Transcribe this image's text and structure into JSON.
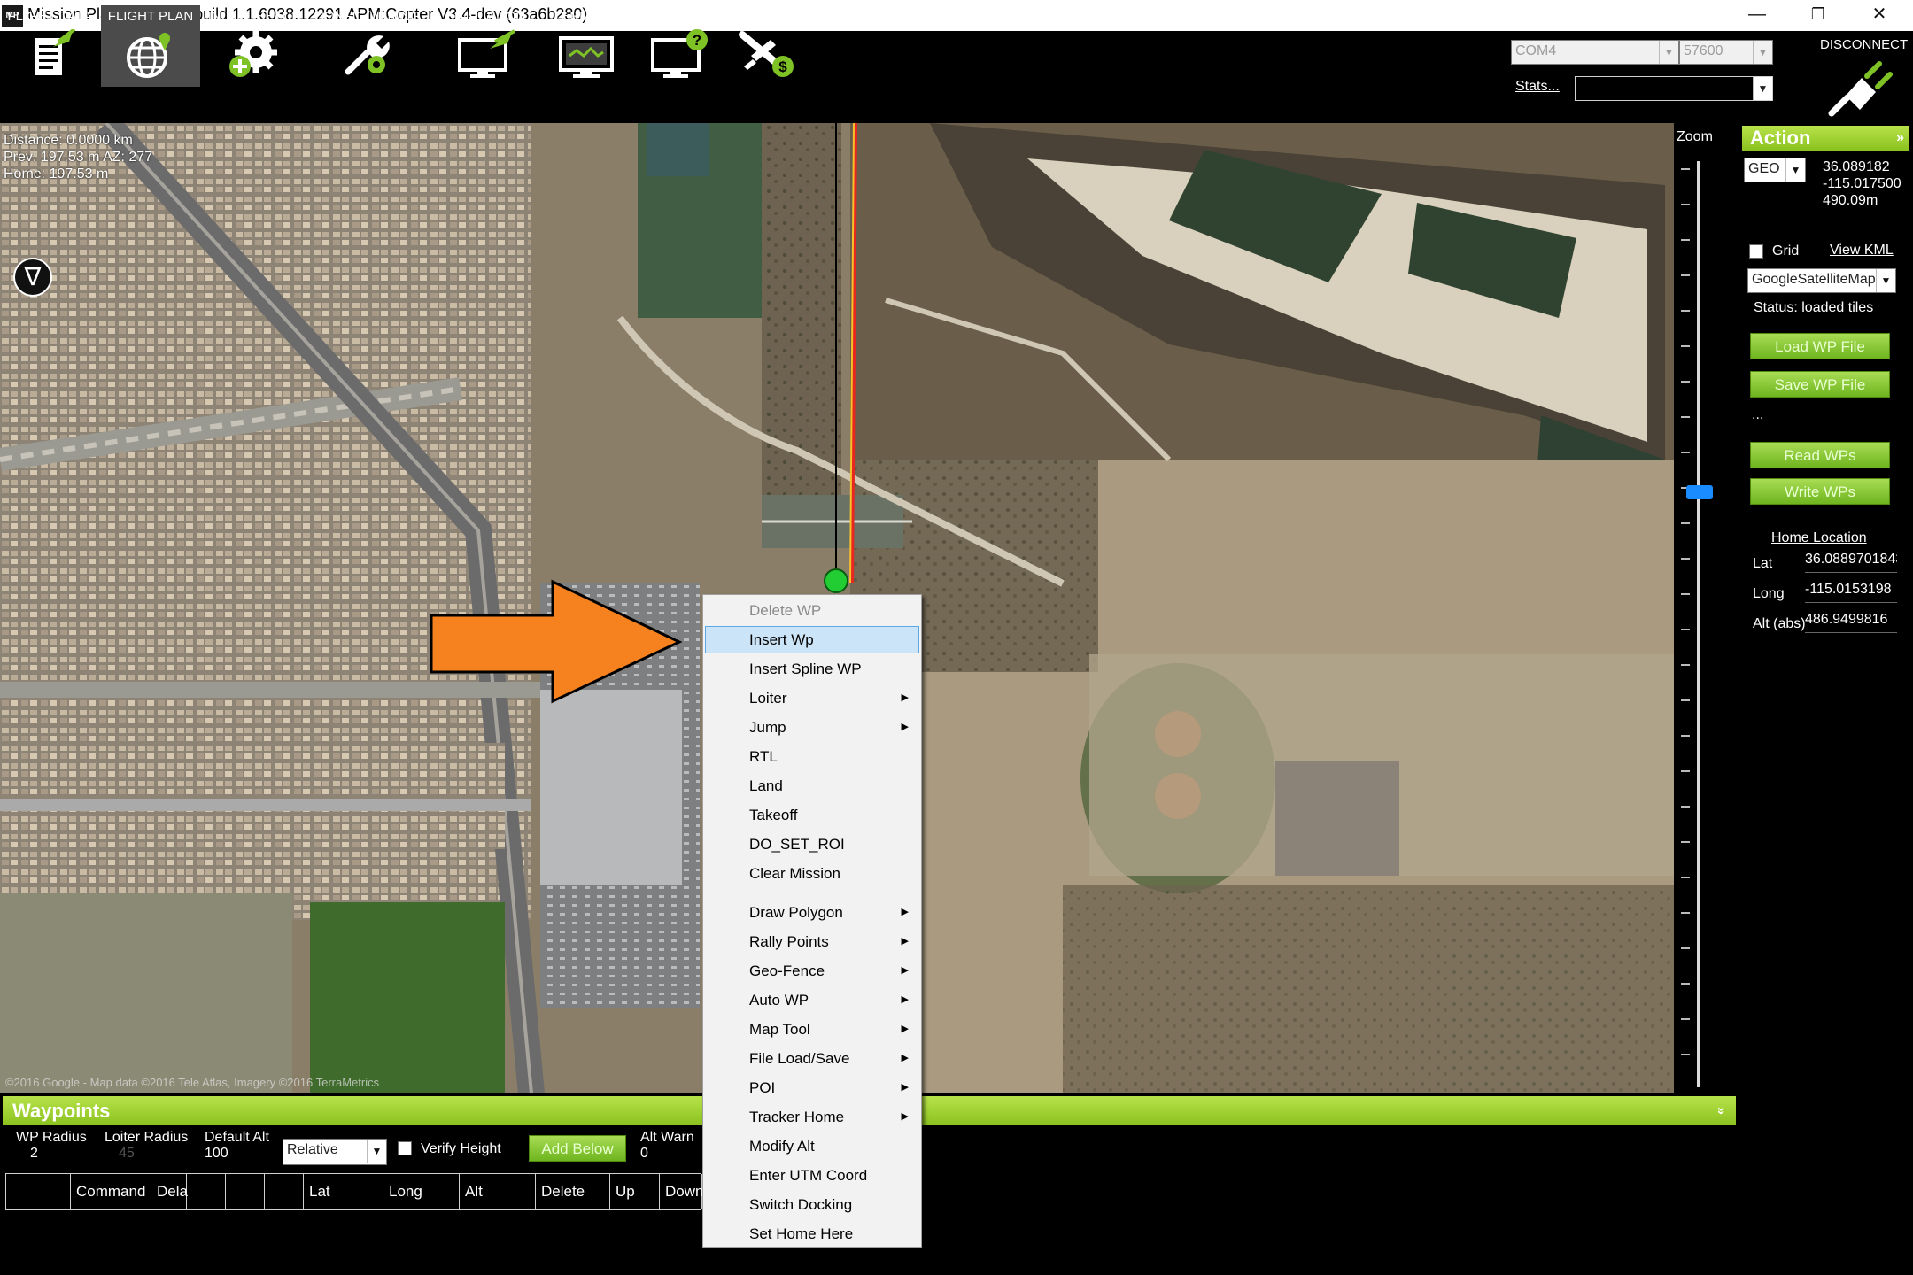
{
  "window": {
    "title": "Mission Planner 1.3.39 build 1.1.6038.12291 APM:Copter V3.4-dev (63a6b280)",
    "icon_label": "MP",
    "minimize_glyph": "—",
    "restore_glyph": "❐",
    "close_glyph": "✕"
  },
  "toolbar": {
    "items": [
      {
        "label": "FLIGHT DATA",
        "icon": "flight-data-icon"
      },
      {
        "label": "FLIGHT PLAN",
        "icon": "flight-plan-icon",
        "active": true
      },
      {
        "label": "INITIAL SETUP",
        "icon": "initial-setup-icon"
      },
      {
        "label": "CONFIG/TUNING",
        "icon": "config-tuning-icon"
      },
      {
        "label": "SIMULATION",
        "icon": "simulation-icon"
      },
      {
        "label": "TERMINAL",
        "icon": "terminal-icon"
      },
      {
        "label": "HELP",
        "icon": "help-icon"
      },
      {
        "label": "DONATE",
        "icon": "donate-icon"
      }
    ],
    "port": "COM4",
    "baud": "57600",
    "stats_link": "Stats...",
    "disconnect_label": "DISCONNECT",
    "combo_arrow": "⌵"
  },
  "map": {
    "distance": "Distance: 0.0000 km",
    "prev": "Prev: 197.53 m AZ: 277",
    "home": "Home: 197.53 m",
    "compass_glyph": "∇",
    "copyright": "©2016 Google - Map data ©2016 Tele Atlas, Imagery ©2016 TerraMetrics",
    "zoom_label": "Zoom",
    "zoom_level": 0.35
  },
  "action_panel": {
    "title": "Action",
    "collapse_glyph": "»",
    "coord_system": "GEO",
    "lat": "36.089182",
    "lng": "-115.017500",
    "alt": "490.09m",
    "grid_label": "Grid",
    "view_kml": "View KML",
    "map_provider": "GoogleSatelliteMap",
    "status": "Status: loaded tiles",
    "load_wp": "Load WP File",
    "save_wp": "Save WP File",
    "ellipsis": "...",
    "read_wps": "Read WPs",
    "write_wps": "Write WPs",
    "home_location": "Home Location",
    "home_lat_label": "Lat",
    "home_lat": "36.0889701843",
    "home_long_label": "Long",
    "home_long": "-115.0153198",
    "home_alt_label": "Alt (abs)",
    "home_alt": "486.9499816"
  },
  "waypoints": {
    "title": "Waypoints",
    "collapse_glyph": "»",
    "wp_radius_label": "WP Radius",
    "wp_radius": "2",
    "loiter_radius_label": "Loiter Radius",
    "loiter_radius": "45",
    "default_alt_label": "Default Alt",
    "default_alt": "100",
    "alt_mode": "Relative",
    "verify_height": "Verify Height",
    "add_below": "Add Below",
    "alt_warn_label": "Alt Warn",
    "alt_warn": "0",
    "columns": [
      "",
      "Command",
      "Dela",
      "",
      "",
      "",
      "Lat",
      "Long",
      "Alt",
      "Delete",
      "Up",
      "Down"
    ]
  },
  "context_menu": {
    "items": [
      {
        "label": "Delete WP",
        "disabled": true
      },
      {
        "label": "Insert Wp",
        "hover": true
      },
      {
        "label": "Insert Spline WP"
      },
      {
        "label": "Loiter",
        "submenu": true
      },
      {
        "label": "Jump",
        "submenu": true
      },
      {
        "label": "RTL"
      },
      {
        "label": "Land"
      },
      {
        "label": "Takeoff"
      },
      {
        "label": "DO_SET_ROI"
      },
      {
        "label": "Clear Mission"
      },
      {
        "label": "Draw Polygon",
        "submenu": true
      },
      {
        "label": "Rally Points",
        "submenu": true
      },
      {
        "label": "Geo-Fence",
        "submenu": true
      },
      {
        "label": "Auto WP",
        "submenu": true
      },
      {
        "label": "Map Tool",
        "submenu": true
      },
      {
        "label": "File Load/Save",
        "submenu": true
      },
      {
        "label": "POI",
        "submenu": true
      },
      {
        "label": "Tracker Home",
        "submenu": true
      },
      {
        "label": "Modify Alt"
      },
      {
        "label": "Enter UTM Coord"
      },
      {
        "label": "Switch Docking"
      },
      {
        "label": "Set Home Here"
      }
    ],
    "submenu_glyph": "▶"
  },
  "colors": {
    "panel_green": "#8bc21f",
    "menu_hover": "#cce4f7",
    "arrow_orange": "#f5821f",
    "home_marker": "#22cc33",
    "path_red": "#e8281e"
  }
}
